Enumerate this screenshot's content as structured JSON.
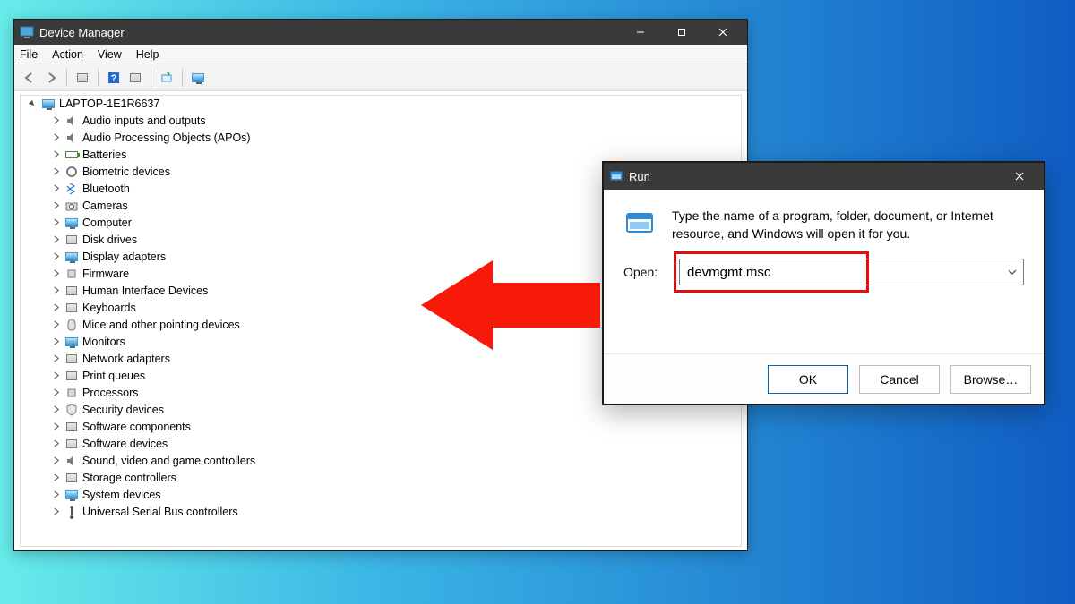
{
  "devmgr": {
    "title": "Device Manager",
    "menu": {
      "file": "File",
      "action": "Action",
      "view": "View",
      "help": "Help"
    },
    "root": "LAPTOP-1E1R6637",
    "categories": [
      "Audio inputs and outputs",
      "Audio Processing Objects (APOs)",
      "Batteries",
      "Biometric devices",
      "Bluetooth",
      "Cameras",
      "Computer",
      "Disk drives",
      "Display adapters",
      "Firmware",
      "Human Interface Devices",
      "Keyboards",
      "Mice and other pointing devices",
      "Monitors",
      "Network adapters",
      "Print queues",
      "Processors",
      "Security devices",
      "Software components",
      "Software devices",
      "Sound, video and game controllers",
      "Storage controllers",
      "System devices",
      "Universal Serial Bus controllers"
    ]
  },
  "run": {
    "title": "Run",
    "description": "Type the name of a program, folder, document, or Internet resource, and Windows will open it for you.",
    "open_label": "Open:",
    "input_value": "devmgmt.msc",
    "buttons": {
      "ok": "OK",
      "cancel": "Cancel",
      "browse": "Browse…"
    }
  },
  "colors": {
    "titlebar": "#3a3a3a",
    "accent": "#0067c0",
    "highlight": "#e60c0c",
    "arrow": "#f71a0b"
  }
}
